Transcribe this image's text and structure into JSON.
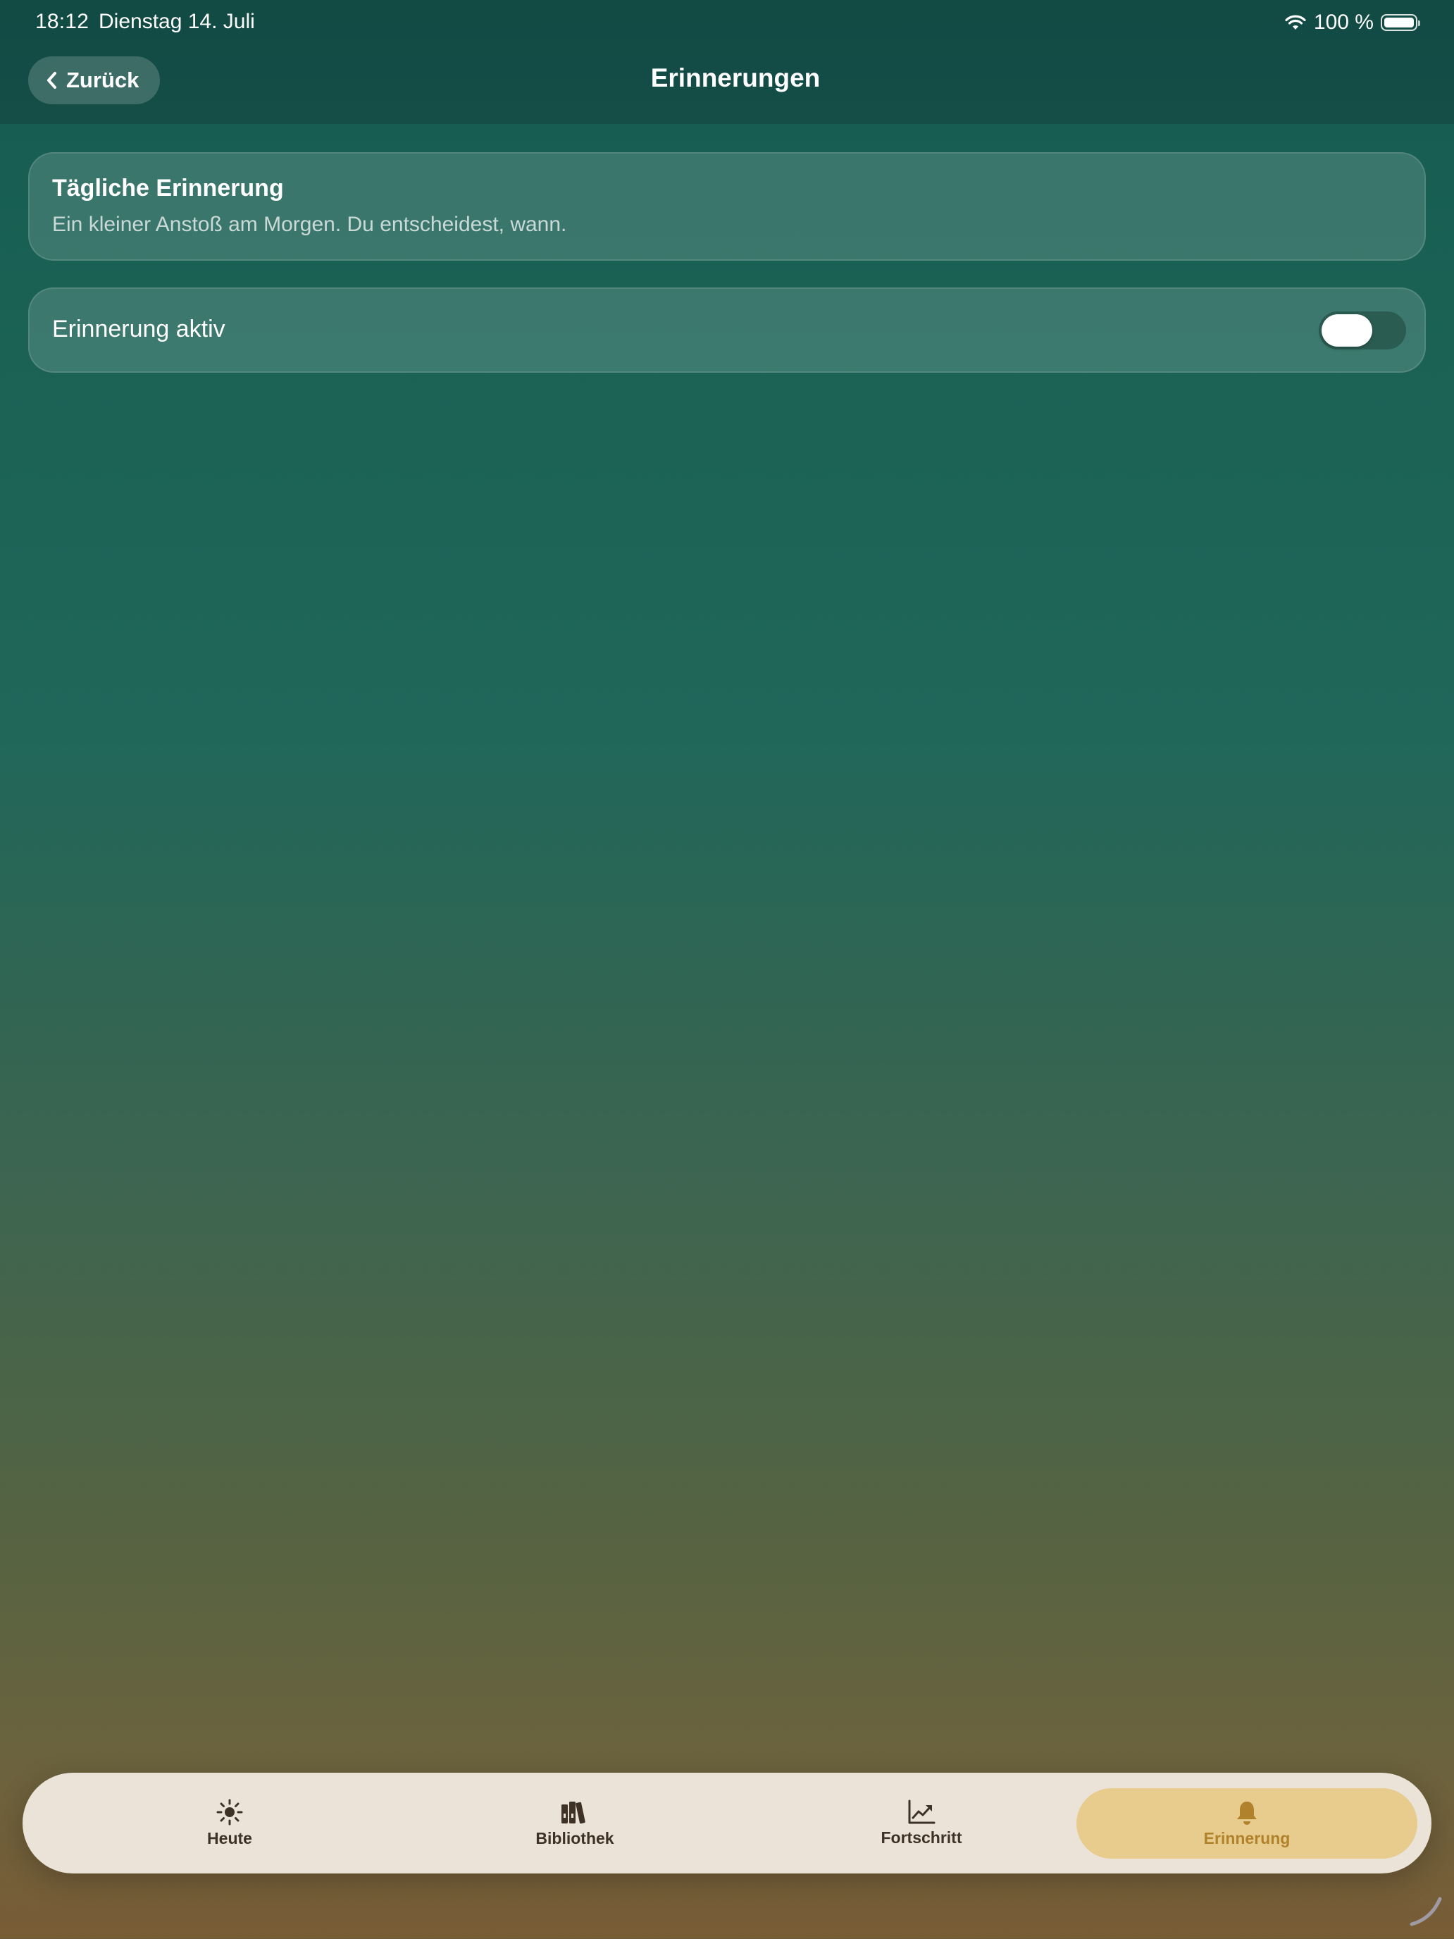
{
  "status_bar": {
    "time": "18:12",
    "date": "Dienstag 14. Juli",
    "battery": "100 %",
    "icons": [
      "wifi-icon",
      "battery-icon"
    ]
  },
  "nav": {
    "back_label": "Zurück",
    "back_icon": "chevron-left-icon",
    "title": "Erinnerungen"
  },
  "intro_card": {
    "title": "Tägliche Erinnerung",
    "subtitle": "Ein kleiner Anstoß am Morgen. Du entscheidest, wann."
  },
  "reminder_toggle": {
    "label": "Erinnerung aktiv",
    "enabled": false
  },
  "tab_bar": {
    "items": [
      {
        "label": "Heute",
        "icon": "sun-icon",
        "selected": false
      },
      {
        "label": "Bibliothek",
        "icon": "books-icon",
        "selected": false
      },
      {
        "label": "Fortschritt",
        "icon": "chart-icon",
        "selected": false
      },
      {
        "label": "Erinnerung",
        "icon": "bell-icon",
        "selected": true
      }
    ]
  },
  "colors": {
    "background_top": "#155a51",
    "background_bottom": "#785c36",
    "tab_bar_bg": "#ebe3d8",
    "tab_active_bg": "#e8cc8e",
    "tab_active_text": "#b0822c",
    "tab_text": "#3e3226"
  }
}
